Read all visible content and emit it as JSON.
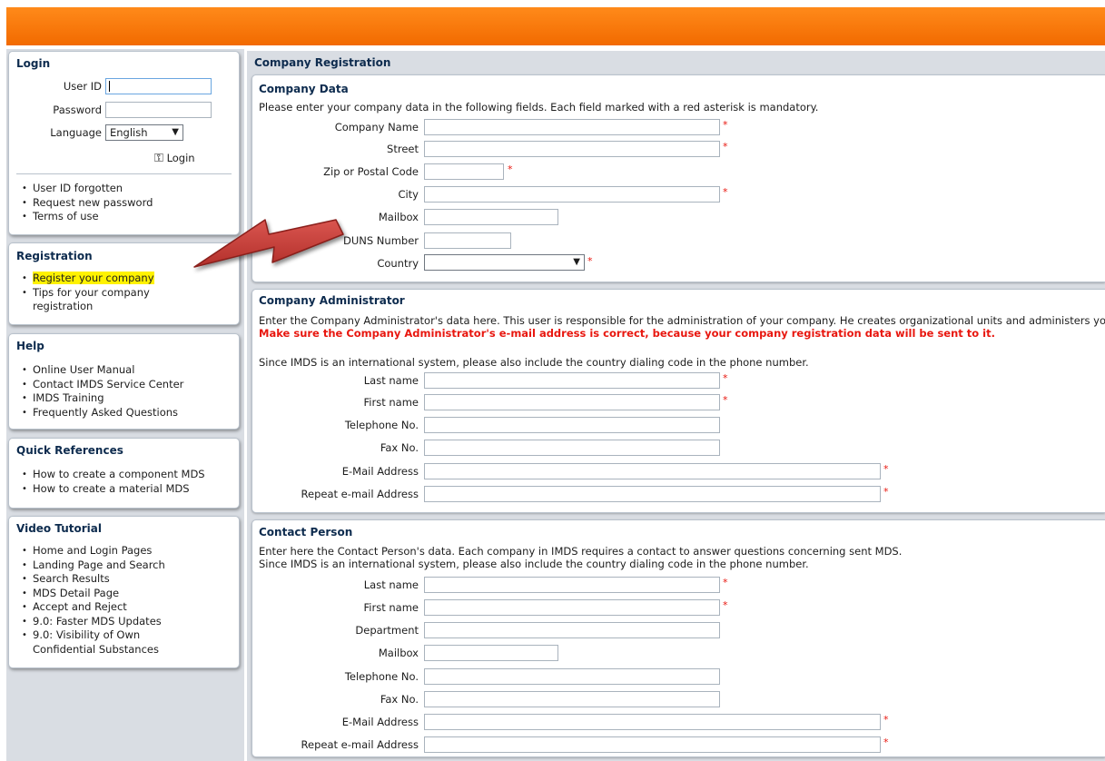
{
  "login": {
    "title": "Login",
    "userid_label": "User ID",
    "password_label": "Password",
    "language_label": "Language",
    "language_value": "English",
    "login_button": "Login",
    "links": [
      "User ID forgotten",
      "Request new password",
      "Terms of use"
    ]
  },
  "registration": {
    "title": "Registration",
    "links": [
      "Register your company",
      "Tips for your company",
      "registration"
    ]
  },
  "help": {
    "title": "Help",
    "links": [
      "Online User Manual",
      "Contact IMDS Service Center",
      "IMDS Training",
      "Frequently Asked Questions"
    ]
  },
  "quick_refs": {
    "title": "Quick References",
    "links": [
      "How to create a component MDS",
      "How to create a material MDS"
    ]
  },
  "video": {
    "title": "Video Tutorial",
    "links": [
      "Home and Login Pages",
      "Landing Page and Search",
      "Search Results",
      "MDS Detail Page",
      "Accept and Reject",
      "9.0: Faster MDS Updates",
      "9.0: Visibility of Own",
      "Confidential Substances"
    ]
  },
  "main": {
    "title": "Company Registration",
    "company_data": {
      "title": "Company Data",
      "intro": "Please enter your company data in the following fields. Each field marked with a red asterisk is mandatory.",
      "fields": [
        "Company Name",
        "Street",
        "Zip or Postal Code",
        "City",
        "Mailbox",
        "DUNS Number",
        "Country"
      ]
    },
    "admin": {
      "title": "Company Administrator",
      "intro": "Enter the Company Administrator's data here. This user is responsible for the administration of your company. He creates organizational units and administers yo",
      "warning": "Make sure the Company Administrator's e-mail address is correct, because your company registration data will be sent to it.",
      "note": "Since IMDS is an international system, please also include the country dialing code in the phone number.",
      "fields": [
        "Last name",
        "First name",
        "Telephone No.",
        "Fax No.",
        "E-Mail Address",
        "Repeat e-mail Address"
      ]
    },
    "contact": {
      "title": "Contact Person",
      "intro": "Enter here the Contact Person's data. Each company in IMDS requires a contact to answer questions concerning sent MDS.",
      "note": "Since IMDS is an international system, please also include the country dialing code in the phone number.",
      "fields": [
        "Last name",
        "First name",
        "Department",
        "Mailbox",
        "Telephone No.",
        "Fax No.",
        "E-Mail Address",
        "Repeat e-mail Address"
      ]
    },
    "asterisk": "*"
  },
  "colors": {
    "header": "#f57a08",
    "title": "#0d2b4e",
    "mandatory": "#e8170f",
    "highlight": "#fff200"
  }
}
